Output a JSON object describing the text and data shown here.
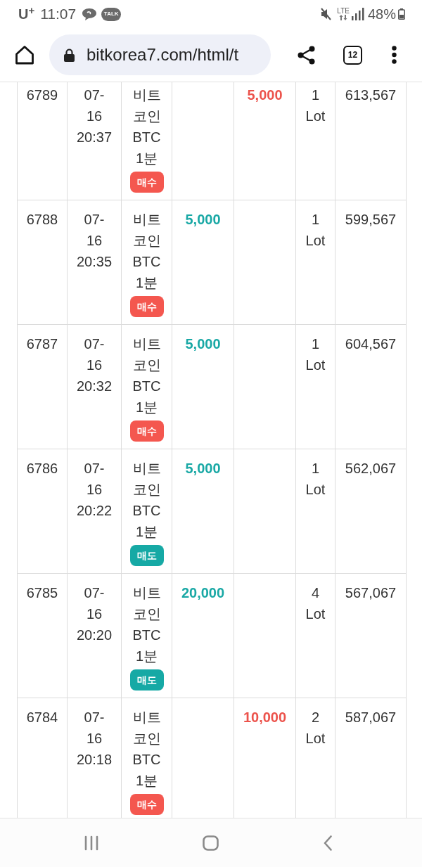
{
  "status_bar": {
    "carrier": "U$^{+}$",
    "time": "11:07",
    "app_badge": "TALK",
    "network": "LTE",
    "battery": "48%"
  },
  "browser": {
    "url": "bitkorea7.com/html/t",
    "tab_count": "12"
  },
  "table": {
    "rows": [
      {
        "column_1": "6789",
        "column_2": {
          "date": "07-16",
          "time": "20:37"
        },
        "column_3": {
          "name": "비트코인 BTC 1분",
          "badge": {
            "label": "매수",
            "color": "#f4574f"
          }
        },
        "column_5": "5,000",
        "column_6": "1 Lot",
        "column_7": "613,567"
      },
      {
        "column_1": "6788",
        "column_2": {
          "date": "07-16",
          "time": "20:35"
        },
        "column_3": {
          "name": "비트코인 BTC 1분",
          "badge": {
            "label": "매수",
            "color": "#f4574f"
          }
        },
        "column_4": "5,000",
        "column_6": "1 Lot",
        "column_7": "599,567"
      },
      {
        "column_1": "6787",
        "column_2": {
          "date": "07-16",
          "time": "20:32"
        },
        "column_3": {
          "name": "비트코인 BTC 1분",
          "badge": {
            "label": "매수",
            "color": "#f4574f"
          }
        },
        "column_4": "5,000",
        "column_6": "1 Lot",
        "column_7": "604,567"
      },
      {
        "column_1": "6786",
        "column_2": {
          "date": "07-16",
          "time": "20:22"
        },
        "column_3": {
          "name": "비트코인 BTC 1분",
          "badge": {
            "label": "매도",
            "color": "#16a9a5"
          }
        },
        "column_4": "5,000",
        "column_6": "1 Lot",
        "column_7": "562,067"
      },
      {
        "column_1": "6785",
        "column_2": {
          "date": "07-16",
          "time": "20:20"
        },
        "column_3": {
          "name": "비트코인 BTC 1분",
          "badge": {
            "label": "매도",
            "color": "#16a9a5"
          }
        },
        "column_4": "20,000",
        "column_6": "4 Lot",
        "column_7": "567,067"
      },
      {
        "column_1": "6784",
        "column_2": {
          "date": "07-16",
          "time": "20:18"
        },
        "column_3": {
          "name": "비트코인 BTC 1분",
          "badge": {
            "label": "매수",
            "color": "#f4574f"
          }
        },
        "column_5": "10,000",
        "column_6": "2 Lot",
        "column_7": "587,067"
      }
    ]
  }
}
